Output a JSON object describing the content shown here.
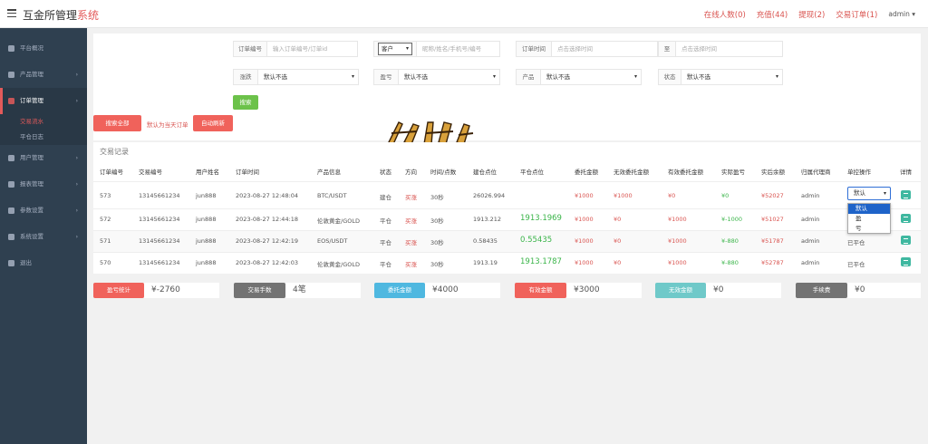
{
  "header": {
    "brand_main": "互金所管理",
    "brand_accent": "系统",
    "nav": [
      "在线人数(0)",
      "充值(44)",
      "提现(2)",
      "交易订单(1)"
    ],
    "user": "admin ▾"
  },
  "sidebar": {
    "items": [
      {
        "label": "平台概况",
        "icon": "dashboard-icon"
      },
      {
        "label": "产品管理",
        "icon": "product-icon"
      },
      {
        "label": "订单管理",
        "icon": "order-icon"
      },
      {
        "label": "用户管理",
        "icon": "user-icon"
      },
      {
        "label": "报表管理",
        "icon": "report-icon"
      },
      {
        "label": "参数设置",
        "icon": "params-icon"
      },
      {
        "label": "系统设置",
        "icon": "settings-icon"
      },
      {
        "label": "退出",
        "icon": "logout-icon"
      }
    ],
    "sub_items": [
      "交易流水",
      "平仓日志"
    ],
    "arrow": "›"
  },
  "filters": {
    "order_no_label": "订单编号",
    "order_no_placeholder": "输入订单编号/订单id",
    "customer_type": "客户",
    "customer_placeholder": "昵称/姓名/手机号/编号",
    "order_time_label": "订单时间",
    "date_from_placeholder": "点击选择时间",
    "to_label": "至",
    "date_to_placeholder": "点击选择时间",
    "direction_label": "涨跌",
    "direction_value": "默认不选",
    "profit_label": "盈亏",
    "profit_value": "默认不选",
    "product_label": "产品",
    "product_value": "默认不选",
    "status_label": "状态",
    "status_value": "默认不选",
    "search_button": "搜索",
    "search_all_button": "搜索全部",
    "today_note": "默认为当天订单",
    "auto_refresh_button": "自动刷新"
  },
  "table": {
    "title": "交易记录",
    "headers": [
      "订单编号",
      "交易编号",
      "用户姓名",
      "订单时间",
      "产品信息",
      "状态",
      "方向",
      "时间/点数",
      "建仓点位",
      "平仓点位",
      "委托金额",
      "无效委托金额",
      "有效委托金额",
      "实际盈亏",
      "实后余额",
      "归属代理商",
      "单控操作",
      "详情"
    ],
    "rows": [
      {
        "order_id": "573",
        "trade_no": "13145661234",
        "user": "jun888",
        "time": "2023-08-27 12:48:04",
        "product": "BTC/USDT",
        "status": "建仓",
        "direction": "买涨",
        "duration": "30秒",
        "open_price": "26026.994",
        "close_price": "",
        "amount": "¥1000",
        "invalid_amount": "¥1000",
        "valid_amount": "¥0",
        "profit": "¥0",
        "balance": "¥52027",
        "agent": "admin",
        "control": ""
      },
      {
        "order_id": "572",
        "trade_no": "13145661234",
        "user": "jun888",
        "time": "2023-08-27 12:44:18",
        "product": "伦敦黄金/GOLD",
        "status": "平仓",
        "direction": "买涨",
        "duration": "30秒",
        "open_price": "1913.212",
        "close_price": "1913.1969",
        "amount": "¥1000",
        "invalid_amount": "¥0",
        "valid_amount": "¥1000",
        "profit": "¥-1000",
        "balance": "¥51027",
        "agent": "admin",
        "control": ""
      },
      {
        "order_id": "571",
        "trade_no": "13145661234",
        "user": "jun888",
        "time": "2023-08-27 12:42:19",
        "product": "EOS/USDT",
        "status": "平仓",
        "direction": "买涨",
        "duration": "30秒",
        "open_price": "0.58435",
        "close_price": "0.55435",
        "amount": "¥1000",
        "invalid_amount": "¥0",
        "valid_amount": "¥1000",
        "profit": "¥-880",
        "balance": "¥51787",
        "agent": "admin",
        "control": "已平仓"
      },
      {
        "order_id": "570",
        "trade_no": "13145661234",
        "user": "jun888",
        "time": "2023-08-27 12:42:03",
        "product": "伦敦黄金/GOLD",
        "status": "平仓",
        "direction": "买涨",
        "duration": "30秒",
        "open_price": "1913.19",
        "close_price": "1913.1787",
        "amount": "¥1000",
        "invalid_amount": "¥0",
        "valid_amount": "¥1000",
        "profit": "¥-880",
        "balance": "¥52787",
        "agent": "admin",
        "control": "已平仓"
      }
    ],
    "control_select_value": "默认",
    "control_options": [
      "默认",
      "盈",
      "亏"
    ]
  },
  "stats": [
    {
      "label": "盈亏统计",
      "value": "¥-2760",
      "color": "#f0625b"
    },
    {
      "label": "交易手数",
      "value": "4笔",
      "color": "#737373"
    },
    {
      "label": "委托金额",
      "value": "¥4000",
      "color": "#4fb8e0"
    },
    {
      "label": "有效金额",
      "value": "¥3000",
      "color": "#f0625b"
    },
    {
      "label": "无效金额",
      "value": "¥0",
      "color": "#6fc9c9"
    },
    {
      "label": "手续费",
      "value": "¥0",
      "color": "#737373"
    }
  ],
  "watermark": {
    "text": "南岳科技"
  },
  "colors": {
    "accent": "#e35a5a",
    "sidebar": "#2f4050",
    "search_green": "#6cc24a",
    "red_button": "#f0625b",
    "detail_teal": "#3fb8a0"
  }
}
